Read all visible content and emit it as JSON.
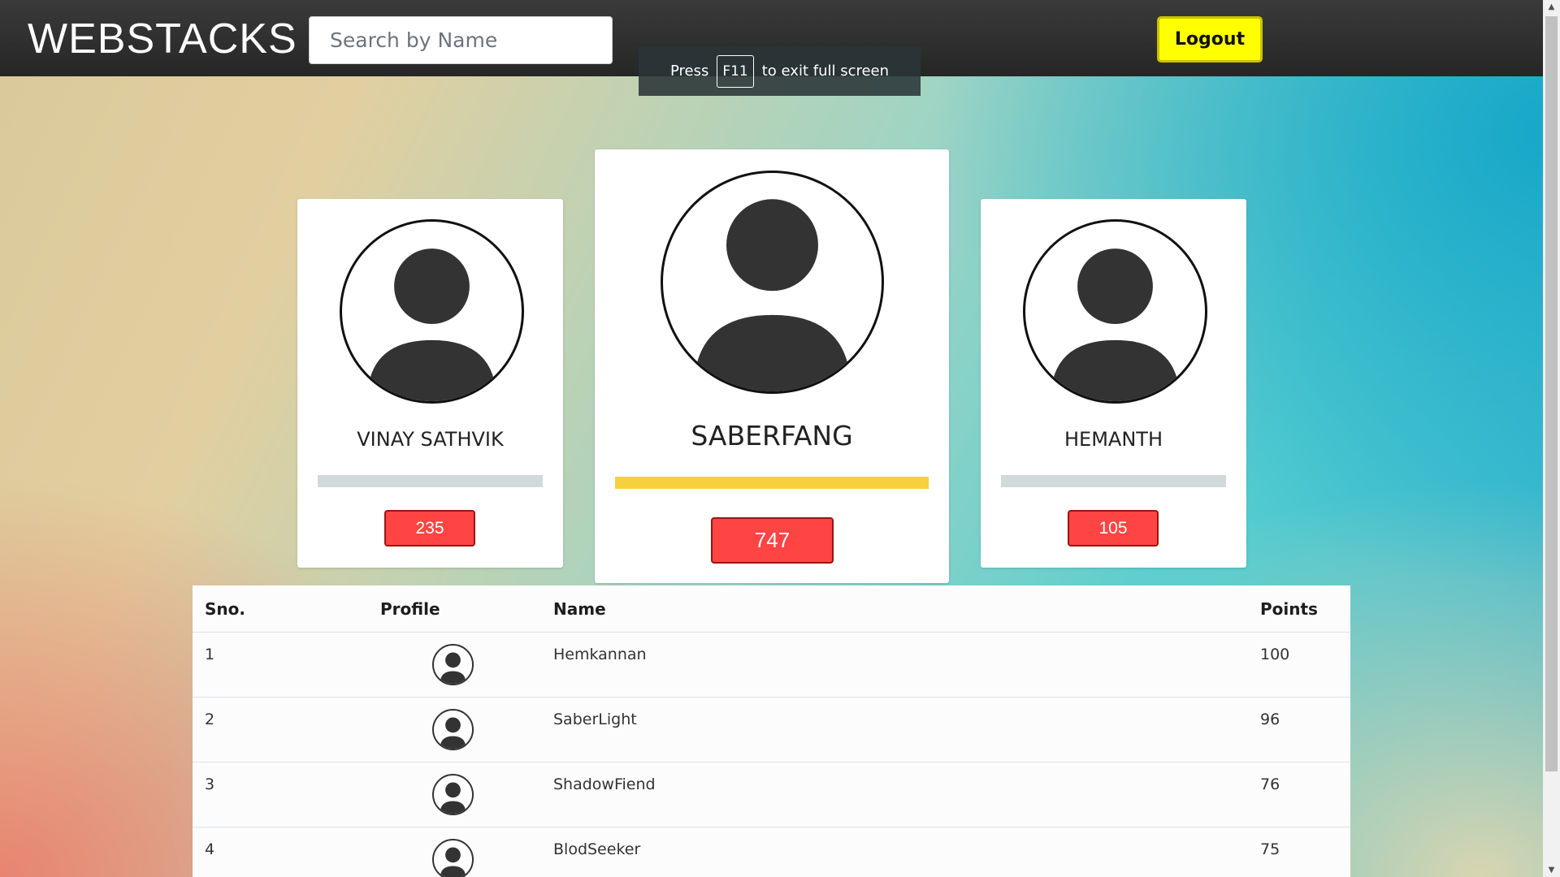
{
  "header": {
    "brand": "WEBSTACKS",
    "search_placeholder": "Search by Name",
    "logout_label": "Logout"
  },
  "fullscreen_notice": {
    "press": "Press",
    "key": "F11",
    "rest": "to exit full screen"
  },
  "podium": {
    "first": {
      "name": "SABERFANG",
      "points": "747",
      "bar_color": "#f6d13d"
    },
    "second": {
      "name": "VINAY SATHVIK",
      "points": "235",
      "bar_color": "#d2d9db"
    },
    "third": {
      "name": "HEMANTH",
      "points": "105",
      "bar_color": "#d2d9db"
    }
  },
  "table": {
    "headers": {
      "sno": "Sno.",
      "profile": "Profile",
      "name": "Name",
      "points": "Points"
    },
    "rows": [
      {
        "sno": "1",
        "name": "Hemkannan",
        "points": "100"
      },
      {
        "sno": "2",
        "name": "SaberLight",
        "points": "96"
      },
      {
        "sno": "3",
        "name": "ShadowFiend",
        "points": "76"
      },
      {
        "sno": "4",
        "name": "BlodSeeker",
        "points": "75"
      }
    ]
  },
  "colors": {
    "accent_logout": "#ffff00",
    "points_badge": "#ff4444",
    "topbar": "#2e2e2e"
  },
  "icons": {
    "avatar": "user-avatar-icon",
    "scroll_up": "chevron-up-icon",
    "scroll_down": "chevron-down-icon"
  }
}
